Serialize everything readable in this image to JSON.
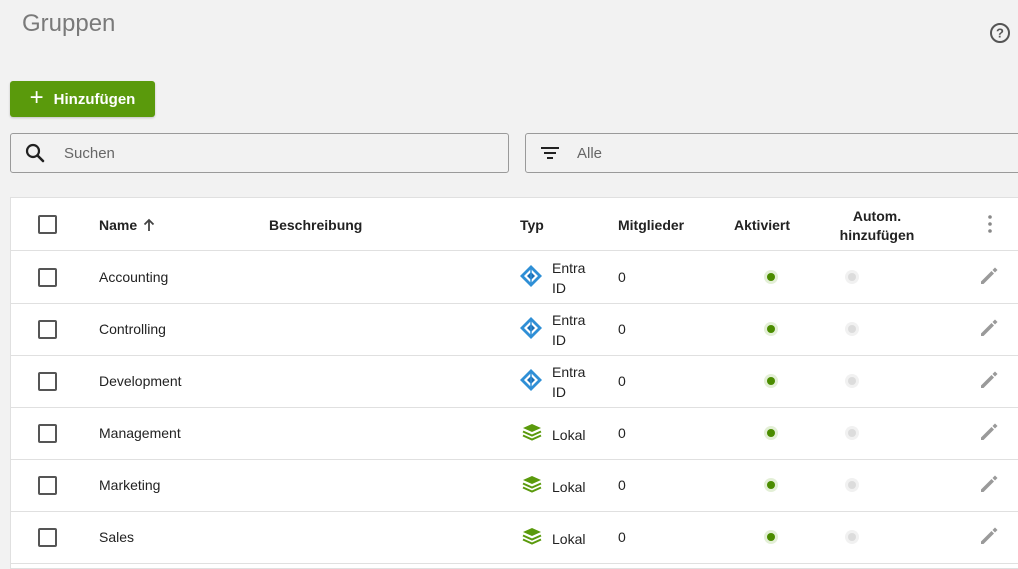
{
  "page": {
    "title": "Gruppen"
  },
  "toolbar": {
    "add_label": "Hinzufügen",
    "add_icon": "plus-icon"
  },
  "search": {
    "placeholder": "Suchen"
  },
  "filter": {
    "value": "Alle"
  },
  "table": {
    "headers": {
      "name": "Name",
      "description": "Beschreibung",
      "type": "Typ",
      "members": "Mitglieder",
      "activated": "Aktiviert",
      "auto_add_line1": "Autom.",
      "auto_add_line2": "hinzufügen"
    },
    "sort": {
      "column": "name",
      "direction": "ascending"
    },
    "rows": [
      {
        "name": "Accounting",
        "description": "",
        "type_line1": "Entra",
        "type_line2": "ID",
        "type_icon": "entra-id-icon",
        "members": "0",
        "activated": true,
        "auto_add": false
      },
      {
        "name": "Controlling",
        "description": "",
        "type_line1": "Entra",
        "type_line2": "ID",
        "type_icon": "entra-id-icon",
        "members": "0",
        "activated": true,
        "auto_add": false
      },
      {
        "name": "Development",
        "description": "",
        "type_line1": "Entra",
        "type_line2": "ID",
        "type_icon": "entra-id-icon",
        "members": "0",
        "activated": true,
        "auto_add": false
      },
      {
        "name": "Management",
        "description": "",
        "type_line1": "Lokal",
        "type_line2": "",
        "type_icon": "local-layers-icon",
        "members": "0",
        "activated": true,
        "auto_add": false
      },
      {
        "name": "Marketing",
        "description": "",
        "type_line1": "Lokal",
        "type_line2": "",
        "type_icon": "local-layers-icon",
        "members": "0",
        "activated": true,
        "auto_add": false
      },
      {
        "name": "Sales",
        "description": "",
        "type_line1": "Lokal",
        "type_line2": "",
        "type_icon": "local-layers-icon",
        "members": "0",
        "activated": true,
        "auto_add": false
      }
    ]
  },
  "colors": {
    "accent": "#5a9a0c",
    "active_dot": "#4b8c00",
    "inactive_dot": "#dcdcdc",
    "entra_blue": "#2f8fd6"
  }
}
